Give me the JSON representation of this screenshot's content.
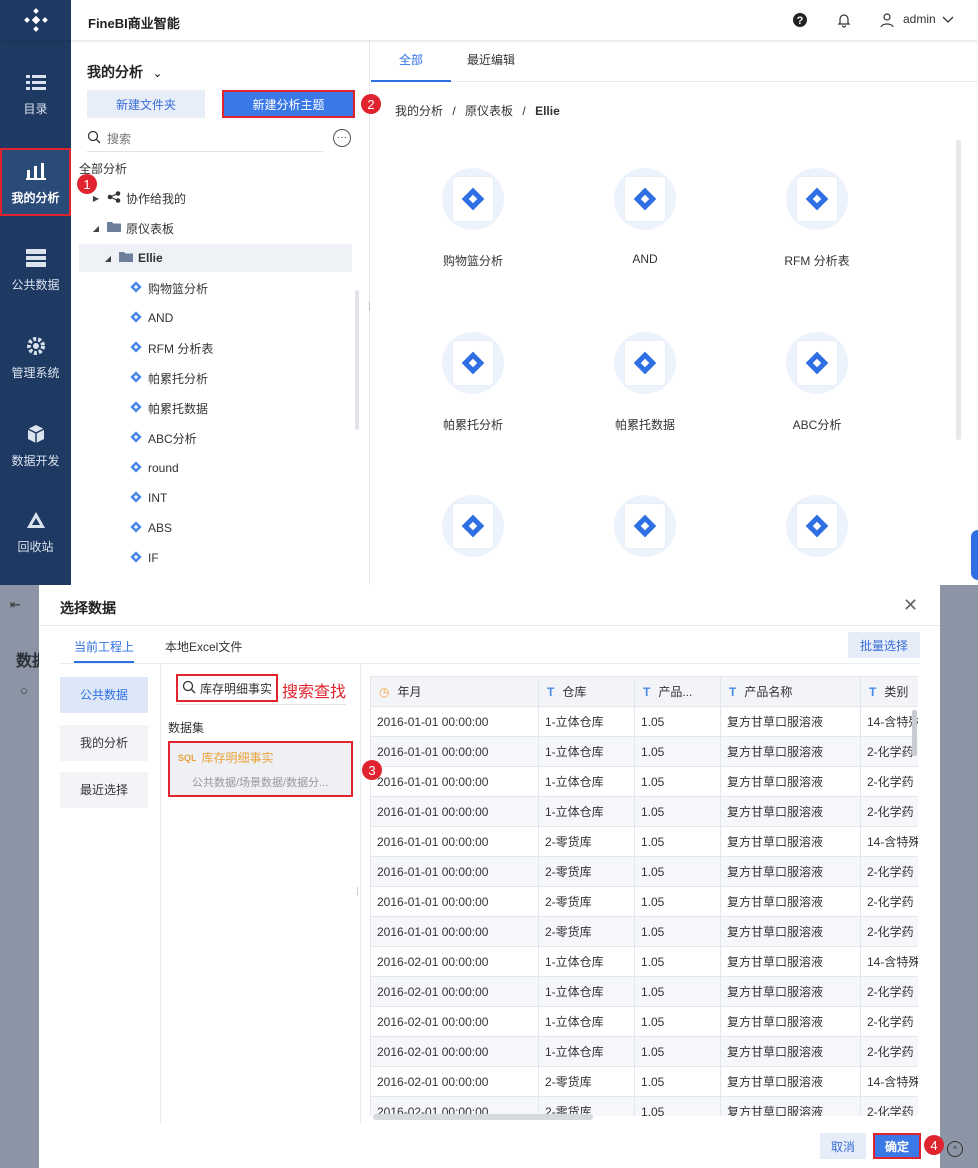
{
  "header": {
    "app_title": "FineBI商业智能",
    "user": "admin"
  },
  "sidebar": [
    {
      "label": "目录",
      "icon": "catalog-icon"
    },
    {
      "label": "我的分析",
      "icon": "analysis-icon"
    },
    {
      "label": "公共数据",
      "icon": "database-icon"
    },
    {
      "label": "管理系统",
      "icon": "gear-icon"
    },
    {
      "label": "数据开发",
      "icon": "cube-icon"
    },
    {
      "label": "回收站",
      "icon": "recycle-icon"
    }
  ],
  "tree": {
    "title": "我的分析",
    "new_folder": "新建文件夹",
    "new_theme": "新建分析主题",
    "search_placeholder": "搜索",
    "root": "全部分析",
    "shared": "协作给我的",
    "folder": "原仪表板",
    "subfolder": "Ellie",
    "items": [
      "购物篮分析",
      "AND",
      "RFM 分析表",
      "帕累托分析",
      "帕累托数据",
      "ABC分析",
      "round",
      "INT",
      "ABS",
      "IF"
    ]
  },
  "content": {
    "tabs": [
      "全部",
      "最近编辑"
    ],
    "breadcrumb": [
      "我的分析",
      "原仪表板",
      "Ellie"
    ],
    "sep": "/",
    "cards": [
      "购物篮分析",
      "AND",
      "RFM 分析表",
      "帕累托分析",
      "帕累托数据",
      "ABC分析"
    ]
  },
  "steps": [
    "1",
    "2",
    "3",
    "4"
  ],
  "bg": {
    "text": "数据"
  },
  "dialog": {
    "title": "选择数据",
    "tabs": [
      "当前工程上",
      "本地Excel文件"
    ],
    "batch": "批量选择",
    "left_tabs": [
      "公共数据",
      "我的分析",
      "最近选择"
    ],
    "search_value": "库存明细事实",
    "search_hint": "搜索查找",
    "dataset_label": "数据集",
    "dataset": {
      "name": "库存明细事实",
      "path": "公共数据/场景数据/数据分..."
    },
    "columns": [
      "年月",
      "仓库",
      "产品...",
      "产品名称",
      "类别"
    ],
    "rows": [
      [
        "2016-01-01 00:00:00",
        "1-立体仓库",
        "1.05",
        "复方甘草口服溶液",
        "14-含特殊"
      ],
      [
        "2016-01-01 00:00:00",
        "1-立体仓库",
        "1.05",
        "复方甘草口服溶液",
        "2-化学药"
      ],
      [
        "2016-01-01 00:00:00",
        "1-立体仓库",
        "1.05",
        "复方甘草口服溶液",
        "2-化学药"
      ],
      [
        "2016-01-01 00:00:00",
        "1-立体仓库",
        "1.05",
        "复方甘草口服溶液",
        "2-化学药"
      ],
      [
        "2016-01-01 00:00:00",
        "2-零货库",
        "1.05",
        "复方甘草口服溶液",
        "14-含特殊"
      ],
      [
        "2016-01-01 00:00:00",
        "2-零货库",
        "1.05",
        "复方甘草口服溶液",
        "2-化学药"
      ],
      [
        "2016-01-01 00:00:00",
        "2-零货库",
        "1.05",
        "复方甘草口服溶液",
        "2-化学药"
      ],
      [
        "2016-01-01 00:00:00",
        "2-零货库",
        "1.05",
        "复方甘草口服溶液",
        "2-化学药"
      ],
      [
        "2016-02-01 00:00:00",
        "1-立体仓库",
        "1.05",
        "复方甘草口服溶液",
        "14-含特殊"
      ],
      [
        "2016-02-01 00:00:00",
        "1-立体仓库",
        "1.05",
        "复方甘草口服溶液",
        "2-化学药"
      ],
      [
        "2016-02-01 00:00:00",
        "1-立体仓库",
        "1.05",
        "复方甘草口服溶液",
        "2-化学药"
      ],
      [
        "2016-02-01 00:00:00",
        "1-立体仓库",
        "1.05",
        "复方甘草口服溶液",
        "2-化学药"
      ],
      [
        "2016-02-01 00:00:00",
        "2-零货库",
        "1.05",
        "复方甘草口服溶液",
        "14-含特殊"
      ],
      [
        "2016-02-01 00:00:00",
        "2-零货库",
        "1.05",
        "复方甘草口服溶液",
        "2-化学药"
      ]
    ],
    "cancel": "取消",
    "ok": "确定"
  }
}
